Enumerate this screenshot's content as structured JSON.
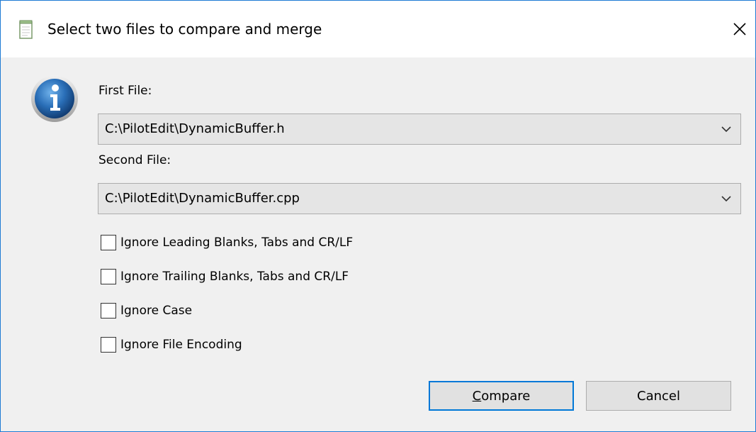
{
  "dialog": {
    "title": "Select two files to compare and merge",
    "close_glyph": "✕"
  },
  "first_file": {
    "label": "First File:",
    "value": "C:\\PilotEdit\\DynamicBuffer.h"
  },
  "second_file": {
    "label": "Second File:",
    "value": "C:\\PilotEdit\\DynamicBuffer.cpp"
  },
  "options": [
    {
      "label": "Ignore Leading Blanks, Tabs and CR/LF",
      "checked": false
    },
    {
      "label": "Ignore Trailing Blanks, Tabs and CR/LF",
      "checked": false
    },
    {
      "label": "Ignore Case",
      "checked": false
    },
    {
      "label": "Ignore File Encoding",
      "checked": false
    }
  ],
  "buttons": {
    "compare_mnemonic": "C",
    "compare_rest": "ompare",
    "cancel": "Cancel"
  },
  "icons": {
    "title": "notepad-icon",
    "info": "info-icon",
    "close": "close-icon",
    "dropdown": "chevron-down-icon"
  },
  "colors": {
    "accent": "#0078d7",
    "window_border": "#1e7bd4",
    "body_bg": "#f0f0f0",
    "combo_bg": "#e5e5e5"
  }
}
